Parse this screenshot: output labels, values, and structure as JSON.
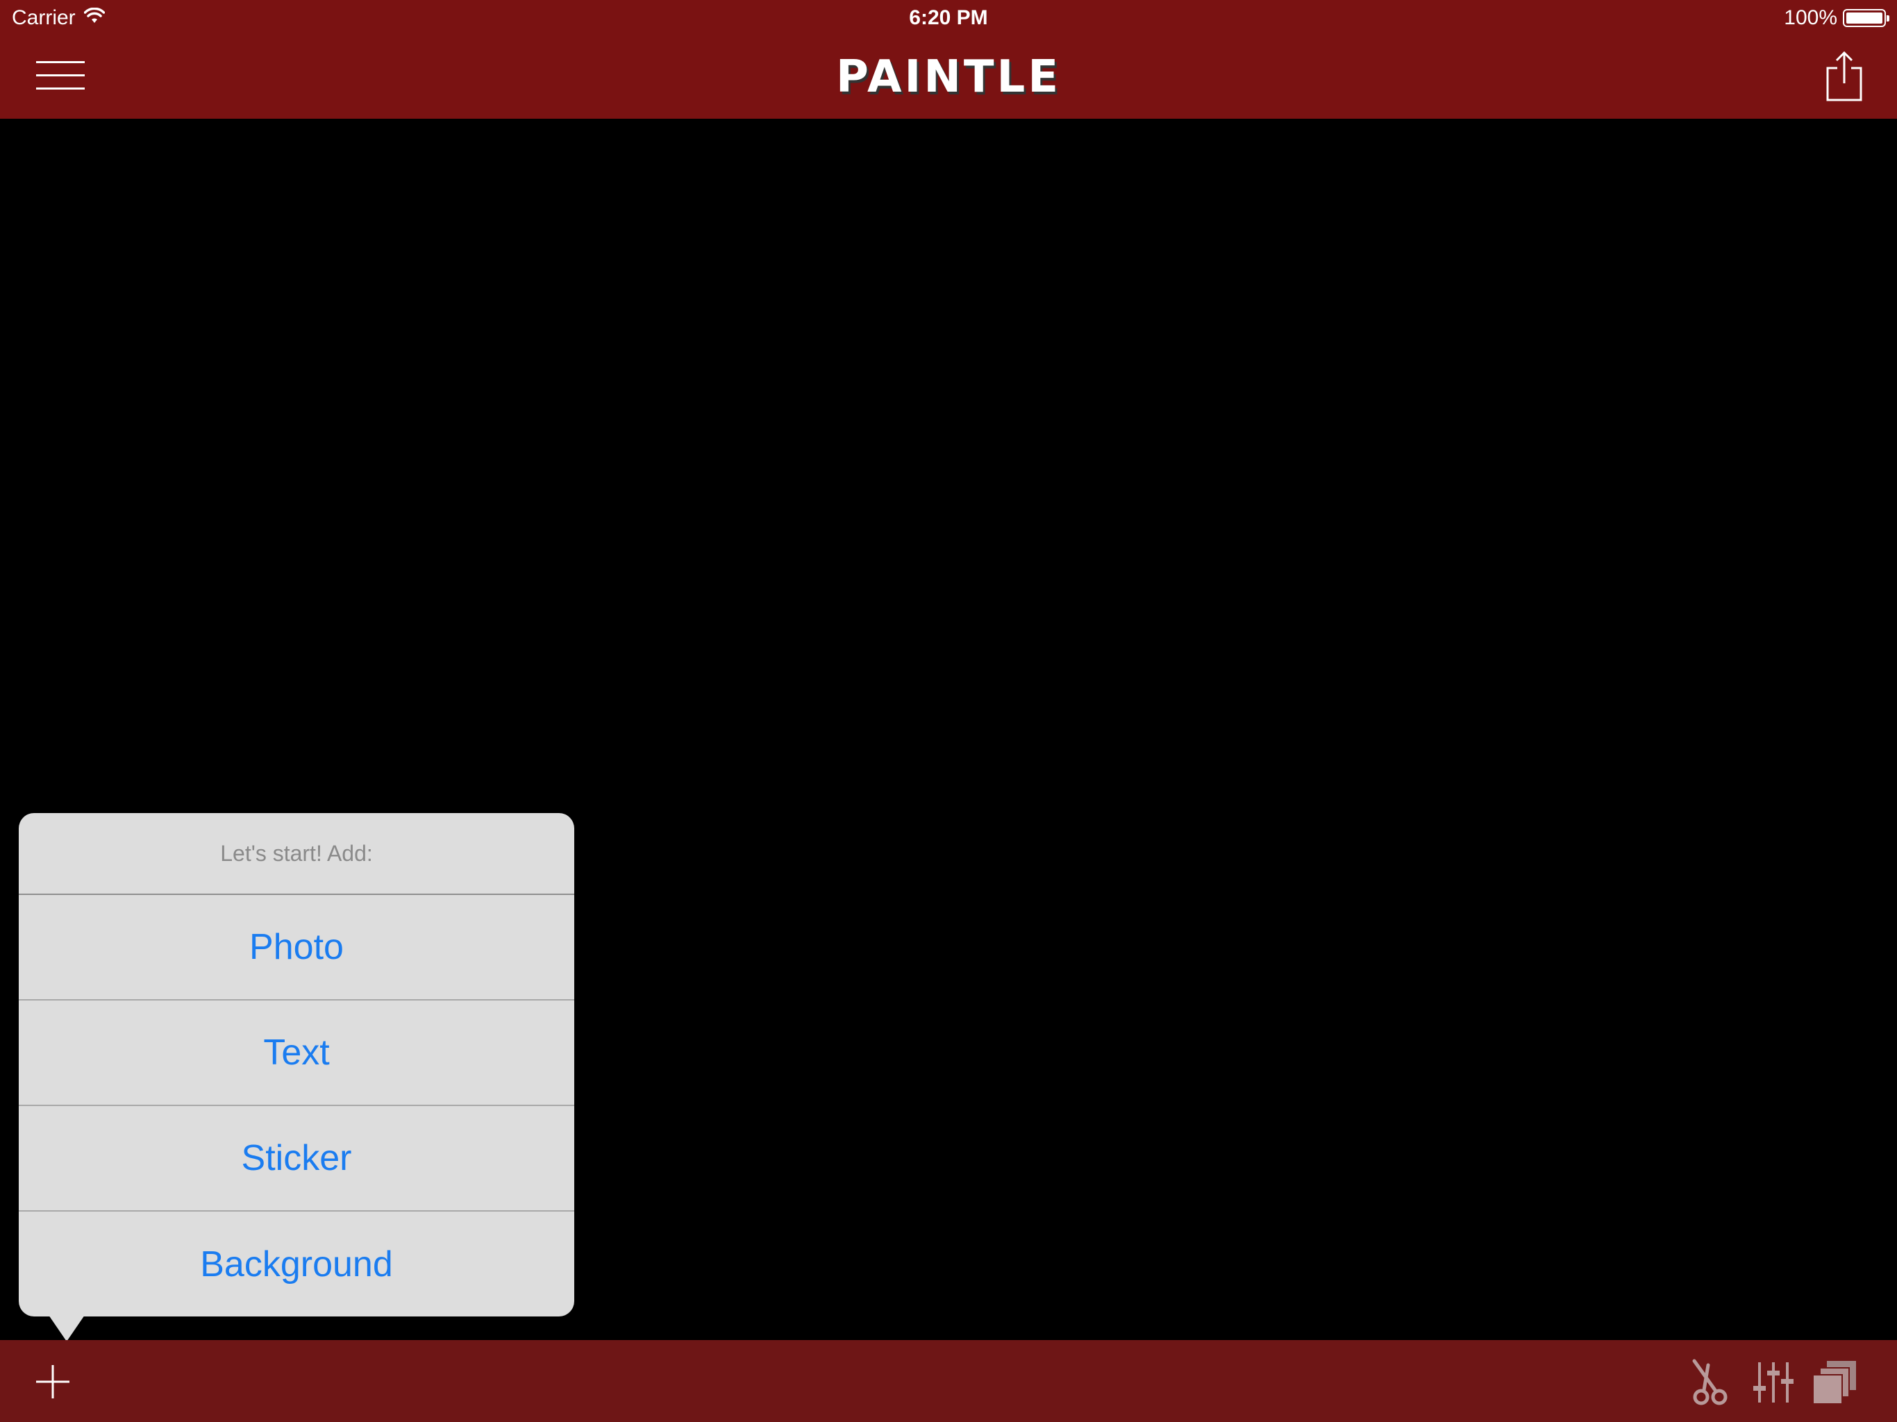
{
  "status_bar": {
    "carrier": "Carrier",
    "time": "6:20 PM",
    "battery_text": "100%",
    "battery_level": 1.0
  },
  "nav_bar": {
    "title": "PAINTLE",
    "menu_icon": "hamburger-menu-icon",
    "share_icon": "share-icon"
  },
  "popover": {
    "header": "Let's start! Add:",
    "items": [
      {
        "label": "Photo"
      },
      {
        "label": "Text"
      },
      {
        "label": "Sticker"
      },
      {
        "label": "Background"
      }
    ]
  },
  "toolbar": {
    "add_icon": "plus-icon",
    "tools": [
      {
        "icon": "scissors-icon"
      },
      {
        "icon": "sliders-icon"
      },
      {
        "icon": "layers-icon"
      }
    ]
  },
  "colors": {
    "nav_background": "#7a1212",
    "toolbar_background": "#6e1616",
    "canvas_background": "#000000",
    "popover_background": "#dddddd",
    "action_blue": "#1a7cf0",
    "disabled_tool": "#b89a9a"
  }
}
